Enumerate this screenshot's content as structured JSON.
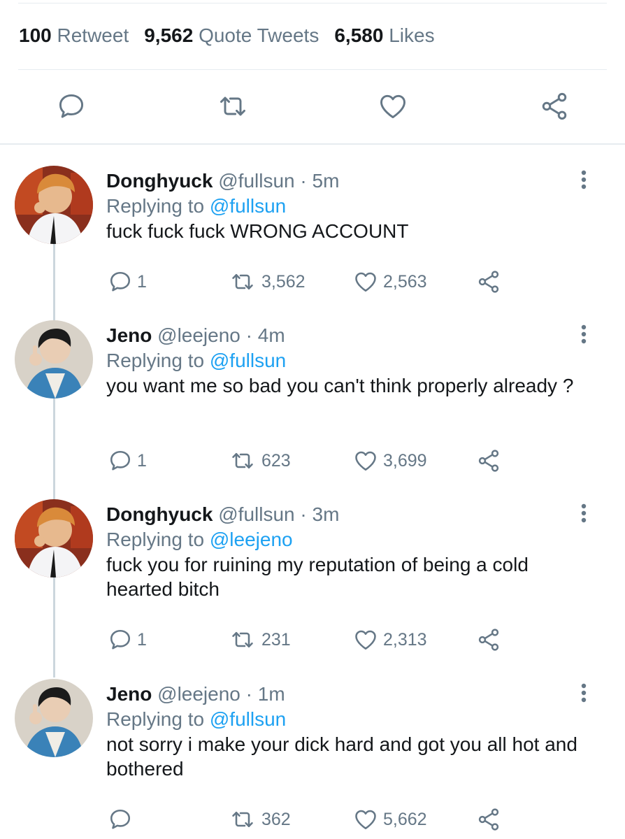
{
  "stats": {
    "retweets": {
      "num": "100",
      "label": "Retweet"
    },
    "quotes": {
      "num": "9,562",
      "label": "Quote Tweets"
    },
    "likes": {
      "num": "6,580",
      "label": "Likes"
    }
  },
  "action_bar": [
    "reply-icon",
    "retweet-icon",
    "like-icon",
    "share-icon"
  ],
  "colors": {
    "text": "#14171a",
    "muted": "#657786",
    "link": "#1da1f2",
    "divider": "#e6ecf0",
    "thread": "#ccd6dd"
  },
  "tweets": [
    {
      "name": "Donghyuck",
      "handle": "@fullsun",
      "time": "5m",
      "replying_label": "Replying to",
      "replying_to": "@fullsun",
      "text": "fuck fuck fuck WRONG ACCOUNT",
      "replies": "1",
      "retweets": "3,562",
      "likes": "2,563"
    },
    {
      "name": "Jeno",
      "handle": "@leejeno",
      "time": "4m",
      "replying_label": "Replying to",
      "replying_to": "@fullsun",
      "text": "you want me so bad you can't think properly already ?",
      "replies": "1",
      "retweets": "623",
      "likes": "3,699"
    },
    {
      "name": "Donghyuck",
      "handle": "@fullsun",
      "time": "3m",
      "replying_label": "Replying to",
      "replying_to": "@leejeno",
      "text": "fuck you for ruining my reputation of being a cold hearted bitch",
      "replies": "1",
      "retweets": "231",
      "likes": "2,313"
    },
    {
      "name": "Jeno",
      "handle": "@leejeno",
      "time": "1m",
      "replying_label": "Replying to",
      "replying_to": "@fullsun",
      "text": "not sorry i make your dick hard and got you all hot and bothered",
      "replies": "",
      "retweets": "362",
      "likes": "5,662"
    }
  ]
}
